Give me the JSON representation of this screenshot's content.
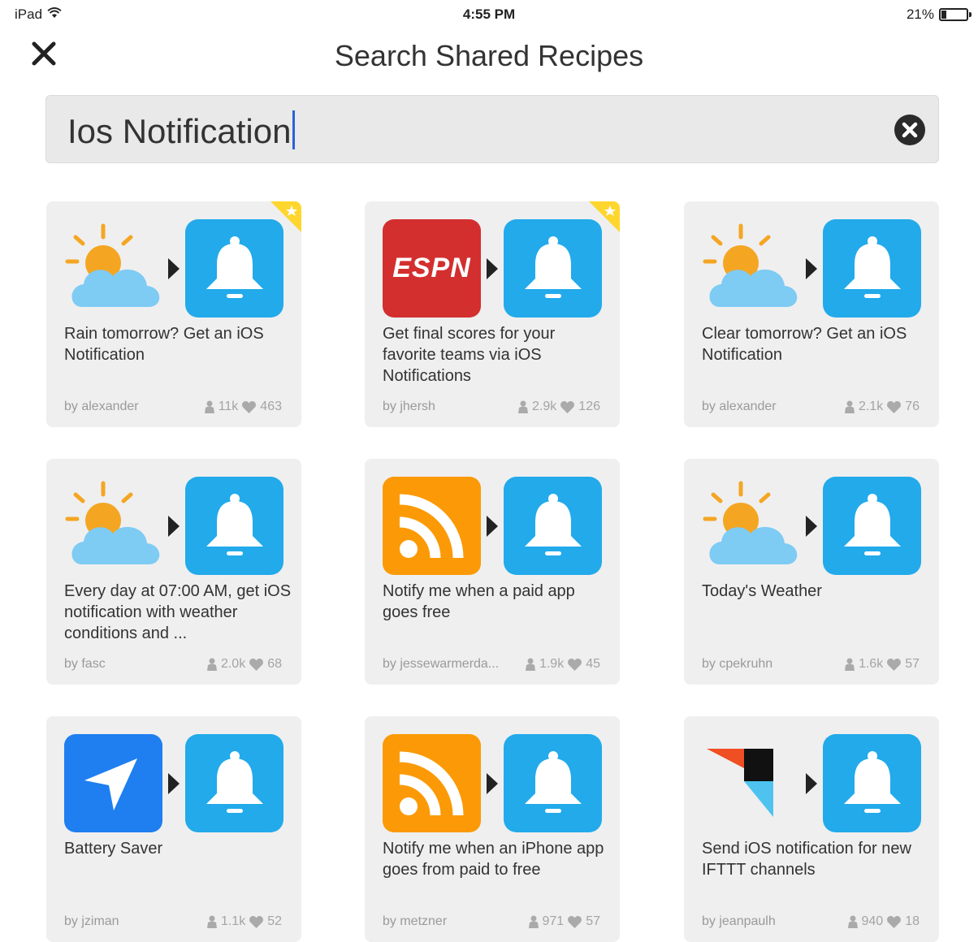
{
  "status_bar": {
    "device": "iPad",
    "time": "4:55 PM",
    "battery": "21%",
    "battery_level": 0.21,
    "wifi_icon": "wifi-icon",
    "battery_icon": "battery-icon"
  },
  "header": {
    "title": "Search Shared Recipes",
    "close_icon": "close-icon"
  },
  "search": {
    "value": "Ios Notification",
    "clear_icon": "clear-search-icon"
  },
  "colors": {
    "action_blue": "#22aaeb",
    "espn_red": "#d32f2f",
    "rss_orange": "#fb9a06",
    "location_blue": "#1f7ff0",
    "card_bg": "#efefef",
    "featured_yellow": "#ffd62e"
  },
  "recipes": [
    {
      "trigger_icon": "weather-icon",
      "featured": true,
      "description": "Rain tomorrow? Get an iOS Notification",
      "author": "by alexander",
      "uses": "11k",
      "likes": "463"
    },
    {
      "trigger_icon": "espn-icon",
      "trigger_label": "ESPN",
      "featured": true,
      "description": "Get final scores for your favorite teams via iOS Notifications",
      "author": "by jhersh",
      "uses": "2.9k",
      "likes": "126"
    },
    {
      "trigger_icon": "weather-icon",
      "featured": false,
      "description": "Clear tomorrow? Get an iOS Notification",
      "author": "by alexander",
      "uses": "2.1k",
      "likes": "76"
    },
    {
      "trigger_icon": "weather-icon",
      "featured": false,
      "description": "Every day at 07:00 AM, get iOS notification with weather conditions and ...",
      "author": "by fasc",
      "uses": "2.0k",
      "likes": "68"
    },
    {
      "trigger_icon": "rss-icon",
      "featured": false,
      "description": "Notify me when a paid app goes free",
      "author": "by jessewarmerda...",
      "uses": "1.9k",
      "likes": "45"
    },
    {
      "trigger_icon": "weather-icon",
      "featured": false,
      "description": "Today's Weather",
      "author": "by cpekruhn",
      "uses": "1.6k",
      "likes": "57"
    },
    {
      "trigger_icon": "location-icon",
      "featured": false,
      "description": "Battery Saver",
      "author": "by jziman",
      "uses": "1.1k",
      "likes": "52"
    },
    {
      "trigger_icon": "rss-icon",
      "featured": false,
      "description": "Notify me when an iPhone app goes from paid to free",
      "author": "by metzner",
      "uses": "971",
      "likes": "57"
    },
    {
      "trigger_icon": "ifttt-icon",
      "featured": false,
      "description": "Send iOS notification for new IFTTT channels",
      "author": "by jeanpaulh",
      "uses": "940",
      "likes": "18"
    }
  ],
  "action_icon": "notification-bell-icon"
}
